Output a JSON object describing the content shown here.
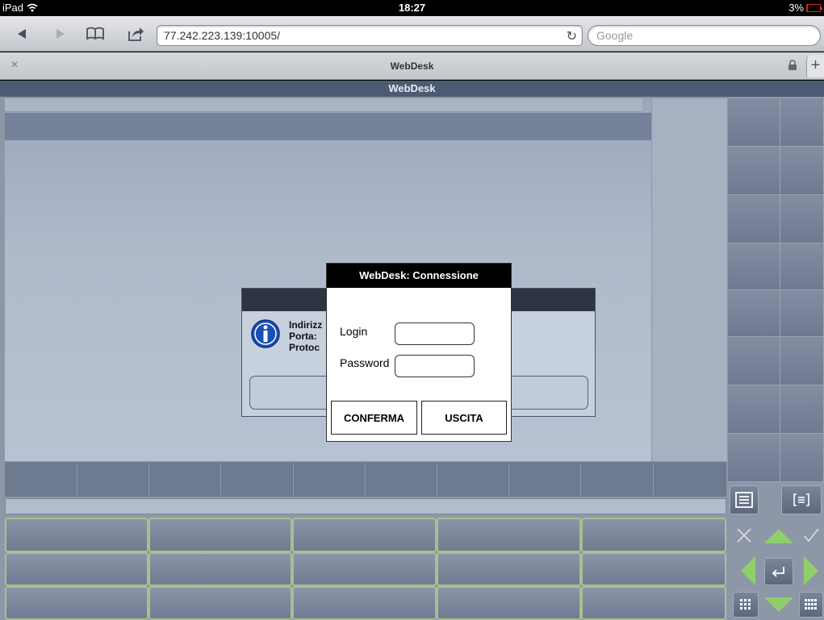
{
  "status_bar": {
    "device": "iPad",
    "time": "18:27",
    "battery": "3%",
    "battery_level": 0.03
  },
  "browser": {
    "url": "77.242.223.139:10005/",
    "search_placeholder": "Google",
    "tab_title": "WebDesk",
    "tab_close": "×",
    "new_tab": "+"
  },
  "page": {
    "header_title": "WebDesk"
  },
  "info_dialog": {
    "lines": "Indirizz\nPorta:\nProtoc"
  },
  "login_dialog": {
    "title": "WebDesk: Connessione",
    "login_label": "Login",
    "password_label": "Password",
    "login_value": "",
    "password_value": "",
    "confirm_label": "CONFERMA",
    "exit_label": "USCITA"
  },
  "colors": {
    "header": "#4d5a73",
    "key_border": "#a7c08f",
    "nav_arrow": "#8fcf6a"
  }
}
